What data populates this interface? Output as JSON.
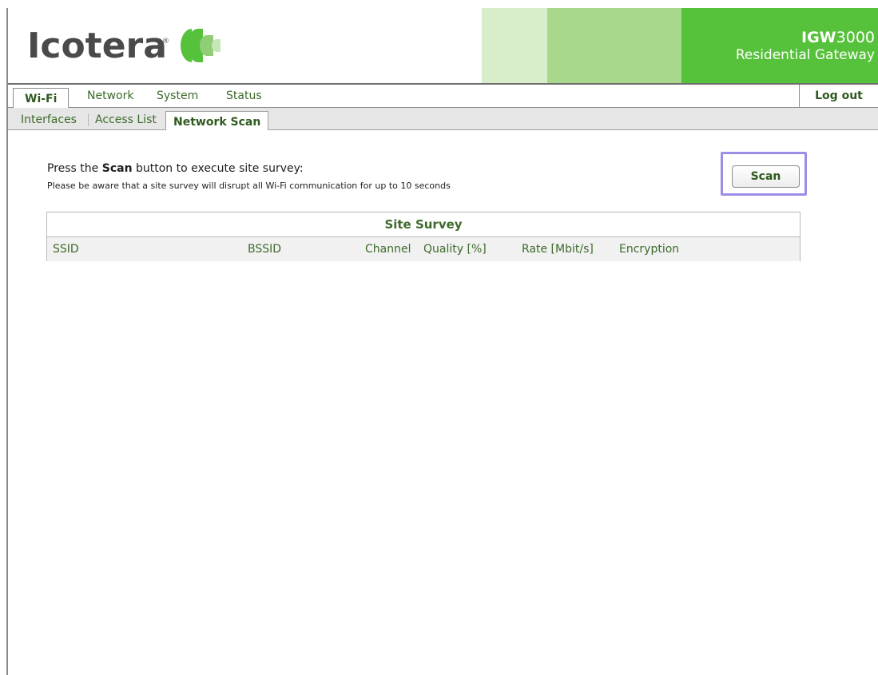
{
  "brand": {
    "logo_text": "Icotera",
    "logo_reg": "®",
    "product_model_bold": "IGW",
    "product_model_num": "3000",
    "product_desc": "Residential Gateway",
    "colors": {
      "green": "#56c13a",
      "light_green": "#a7d88c",
      "pale_green": "#d8edca",
      "tab_text": "#3d6a2a"
    }
  },
  "main_tabs": [
    {
      "label": "Wi-Fi",
      "active": true
    },
    {
      "label": "Network",
      "active": false
    },
    {
      "label": "System",
      "active": false
    },
    {
      "label": "Status",
      "active": false
    }
  ],
  "logout_label": "Log out",
  "sub_tabs": [
    {
      "label": "Interfaces",
      "active": false
    },
    {
      "label": "Access List",
      "active": false
    },
    {
      "label": "Network Scan",
      "active": true
    }
  ],
  "content": {
    "instruction_pre": "Press the ",
    "instruction_bold": "Scan",
    "instruction_post": " button to execute site survey:",
    "warning": "Please be aware that a site survey will disrupt all Wi-Fi communication for up to 10 seconds",
    "scan_button": "Scan"
  },
  "site_survey": {
    "title": "Site Survey",
    "columns": [
      "SSID",
      "BSSID",
      "Channel",
      "Quality [%]",
      "Rate [Mbit/s]",
      "Encryption"
    ],
    "rows": []
  }
}
